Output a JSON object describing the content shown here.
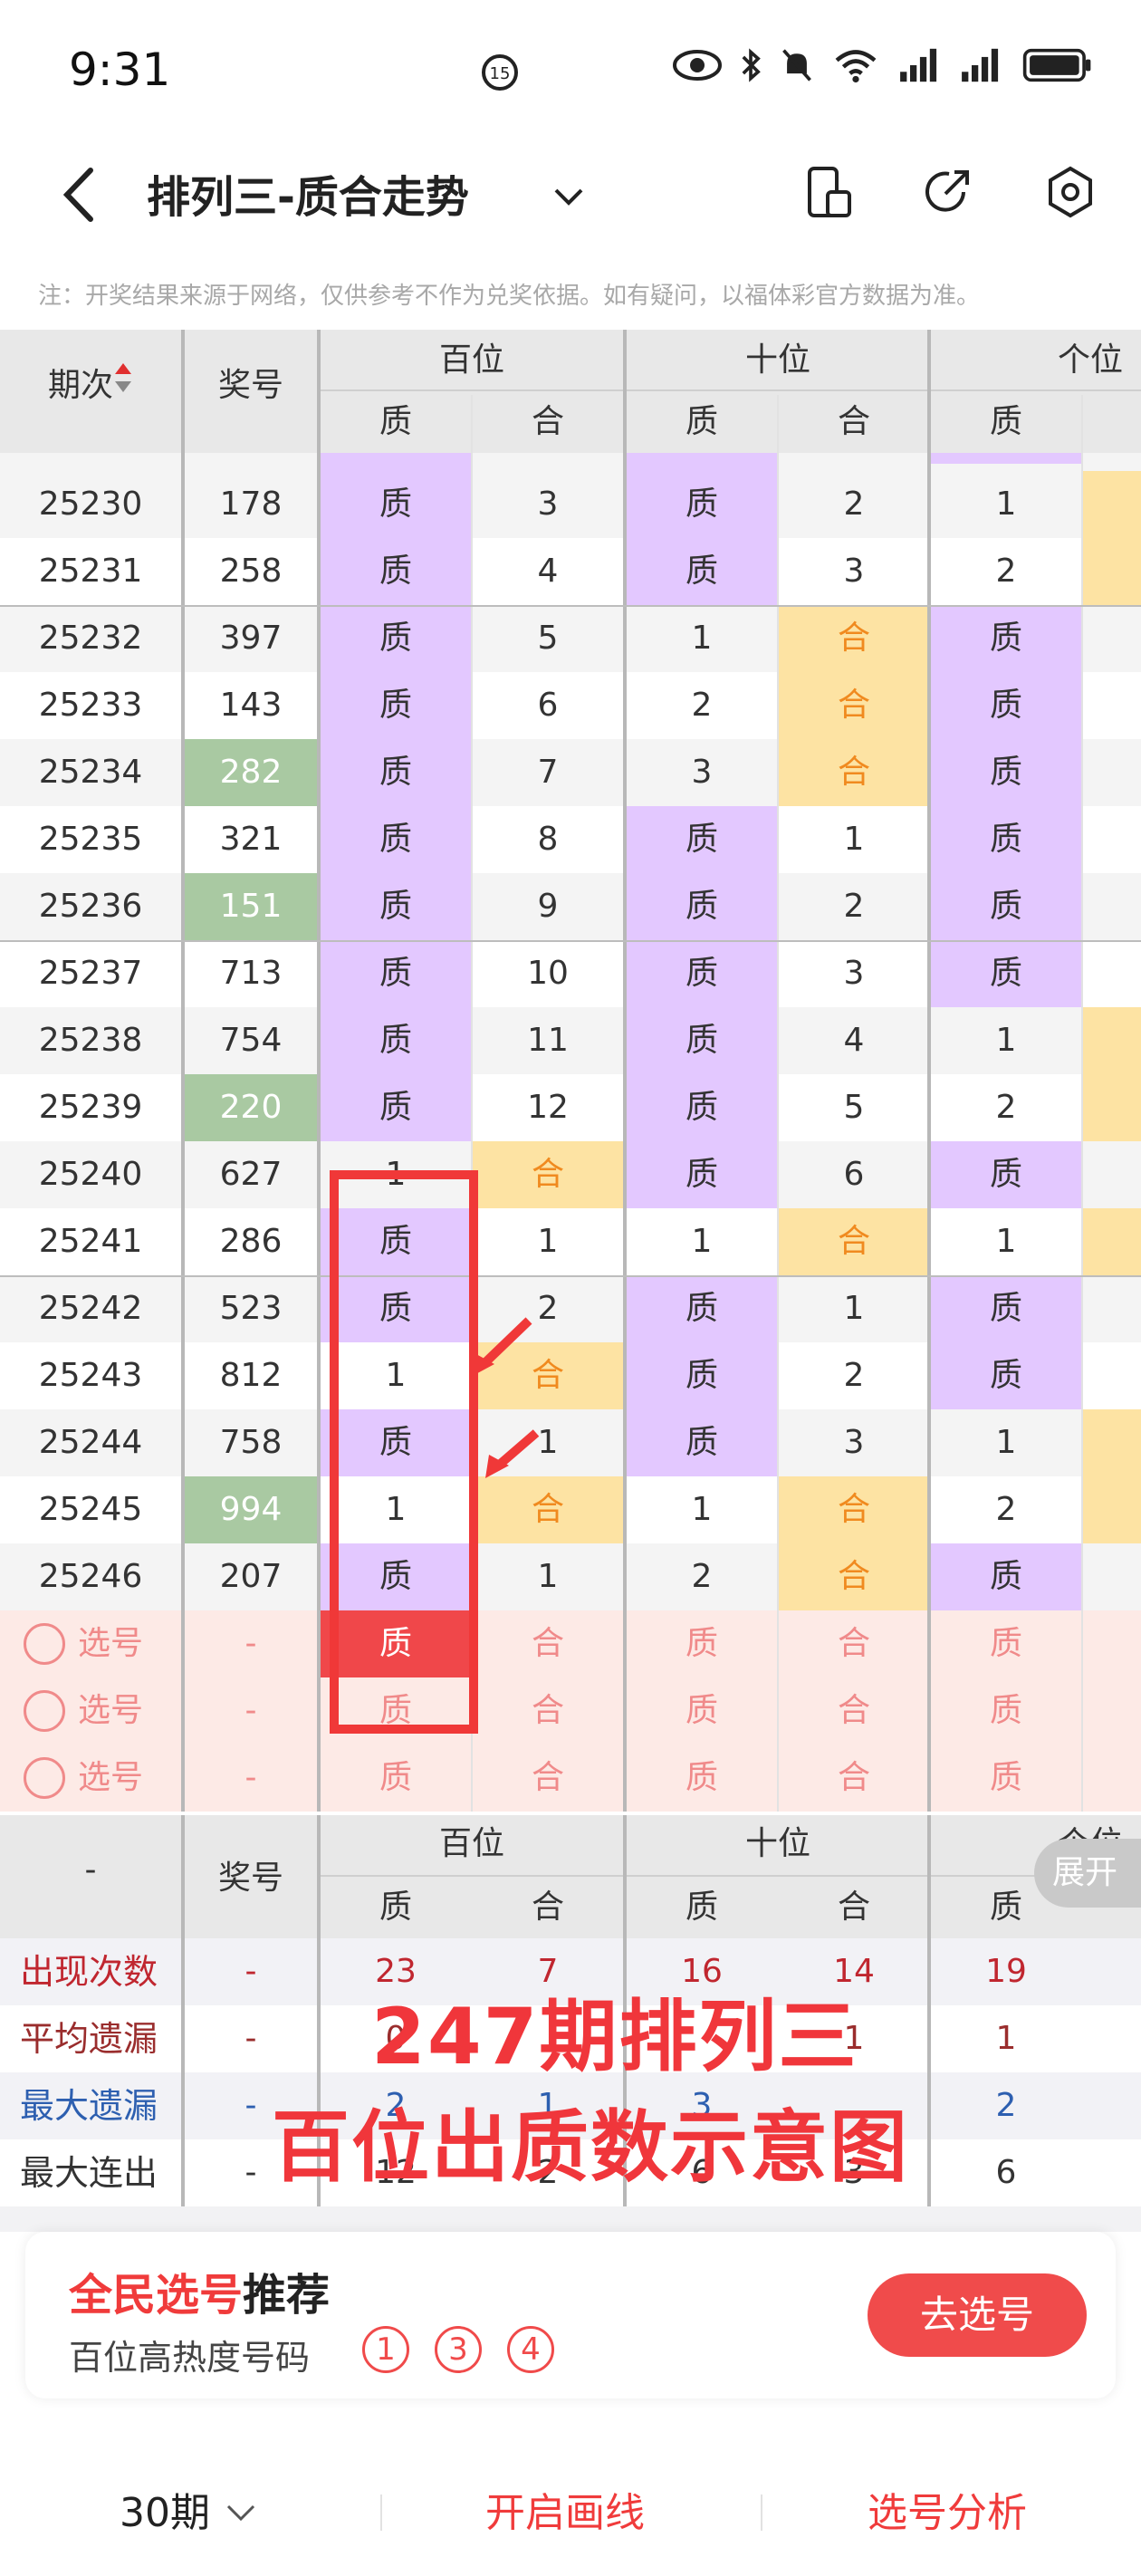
{
  "status_bar": {
    "time": "9:31"
  },
  "nav": {
    "title": "排列三-质合走势"
  },
  "note": "注：开奖结果来源于网络，仅供参考不作为兑奖依据。如有疑问，以福体彩官方数据为准。",
  "table_header": {
    "period": "期次",
    "number": "奖号",
    "groups": [
      "百位",
      "十位",
      "个位"
    ],
    "sub": [
      "质",
      "合",
      "质",
      "合",
      "质"
    ]
  },
  "rows": [
    {
      "period": "25230",
      "num": "178",
      "green": false,
      "c": [
        [
          "质",
          "p"
        ],
        [
          "3",
          ""
        ],
        [
          "质",
          "p"
        ],
        [
          "2",
          ""
        ],
        [
          "1",
          ""
        ]
      ],
      "g": "h"
    },
    {
      "period": "25231",
      "num": "258",
      "green": false,
      "c": [
        [
          "质",
          "p"
        ],
        [
          "4",
          ""
        ],
        [
          "质",
          "p"
        ],
        [
          "3",
          ""
        ],
        [
          "2",
          ""
        ]
      ],
      "g": "h"
    },
    {
      "period": "25232",
      "num": "397",
      "green": false,
      "c": [
        [
          "质",
          "p"
        ],
        [
          "5",
          ""
        ],
        [
          "1",
          ""
        ],
        [
          "合",
          "h"
        ],
        [
          "质",
          "p"
        ]
      ],
      "g": ""
    },
    {
      "period": "25233",
      "num": "143",
      "green": false,
      "c": [
        [
          "质",
          "p"
        ],
        [
          "6",
          ""
        ],
        [
          "2",
          ""
        ],
        [
          "合",
          "h"
        ],
        [
          "质",
          "p"
        ]
      ],
      "g": ""
    },
    {
      "period": "25234",
      "num": "282",
      "green": true,
      "c": [
        [
          "质",
          "p"
        ],
        [
          "7",
          ""
        ],
        [
          "3",
          ""
        ],
        [
          "合",
          "h"
        ],
        [
          "质",
          "p"
        ]
      ],
      "g": ""
    },
    {
      "period": "25235",
      "num": "321",
      "green": false,
      "c": [
        [
          "质",
          "p"
        ],
        [
          "8",
          ""
        ],
        [
          "质",
          "p"
        ],
        [
          "1",
          ""
        ],
        [
          "质",
          "p"
        ]
      ],
      "g": ""
    },
    {
      "period": "25236",
      "num": "151",
      "green": true,
      "c": [
        [
          "质",
          "p"
        ],
        [
          "9",
          ""
        ],
        [
          "质",
          "p"
        ],
        [
          "2",
          ""
        ],
        [
          "质",
          "p"
        ]
      ],
      "g": ""
    },
    {
      "period": "25237",
      "num": "713",
      "green": false,
      "c": [
        [
          "质",
          "p"
        ],
        [
          "10",
          ""
        ],
        [
          "质",
          "p"
        ],
        [
          "3",
          ""
        ],
        [
          "质",
          "p"
        ]
      ],
      "g": ""
    },
    {
      "period": "25238",
      "num": "754",
      "green": false,
      "c": [
        [
          "质",
          "p"
        ],
        [
          "11",
          ""
        ],
        [
          "质",
          "p"
        ],
        [
          "4",
          ""
        ],
        [
          "1",
          ""
        ]
      ],
      "g": "h"
    },
    {
      "period": "25239",
      "num": "220",
      "green": true,
      "c": [
        [
          "质",
          "p"
        ],
        [
          "12",
          ""
        ],
        [
          "质",
          "p"
        ],
        [
          "5",
          ""
        ],
        [
          "2",
          ""
        ]
      ],
      "g": "h"
    },
    {
      "period": "25240",
      "num": "627",
      "green": false,
      "c": [
        [
          "1",
          ""
        ],
        [
          "合",
          "h"
        ],
        [
          "质",
          "p"
        ],
        [
          "6",
          ""
        ],
        [
          "质",
          "p"
        ]
      ],
      "g": ""
    },
    {
      "period": "25241",
      "num": "286",
      "green": false,
      "c": [
        [
          "质",
          "p"
        ],
        [
          "1",
          ""
        ],
        [
          "1",
          ""
        ],
        [
          "合",
          "h"
        ],
        [
          "1",
          ""
        ]
      ],
      "g": "h"
    },
    {
      "period": "25242",
      "num": "523",
      "green": false,
      "c": [
        [
          "质",
          "p"
        ],
        [
          "2",
          ""
        ],
        [
          "质",
          "p"
        ],
        [
          "1",
          ""
        ],
        [
          "质",
          "p"
        ]
      ],
      "g": ""
    },
    {
      "period": "25243",
      "num": "812",
      "green": false,
      "c": [
        [
          "1",
          ""
        ],
        [
          "合",
          "h"
        ],
        [
          "质",
          "p"
        ],
        [
          "2",
          ""
        ],
        [
          "质",
          "p"
        ]
      ],
      "g": ""
    },
    {
      "period": "25244",
      "num": "758",
      "green": false,
      "c": [
        [
          "质",
          "p"
        ],
        [
          "1",
          ""
        ],
        [
          "质",
          "p"
        ],
        [
          "3",
          ""
        ],
        [
          "1",
          ""
        ]
      ],
      "g": "h"
    },
    {
      "period": "25245",
      "num": "994",
      "green": true,
      "c": [
        [
          "1",
          ""
        ],
        [
          "合",
          "h"
        ],
        [
          "1",
          ""
        ],
        [
          "合",
          "h"
        ],
        [
          "2",
          ""
        ]
      ],
      "g": "h"
    },
    {
      "period": "25246",
      "num": "207",
      "green": false,
      "c": [
        [
          "质",
          "p"
        ],
        [
          "1",
          ""
        ],
        [
          "2",
          ""
        ],
        [
          "合",
          "h"
        ],
        [
          "质",
          "p"
        ]
      ],
      "g": ""
    }
  ],
  "pick_rows": [
    {
      "label": "选号",
      "num": "-",
      "c": [
        "质",
        "合",
        "质",
        "合",
        "质"
      ]
    },
    {
      "label": "选号",
      "num": "-",
      "c": [
        "质",
        "合",
        "质",
        "合",
        "质"
      ]
    },
    {
      "label": "选号",
      "num": "-",
      "c": [
        "质",
        "合",
        "质",
        "合",
        "质"
      ]
    }
  ],
  "stats_header": {
    "left": "-",
    "number": "奖号",
    "groups": [
      "百位",
      "十位",
      "个位"
    ],
    "sub": [
      "质",
      "合",
      "质",
      "合",
      "质"
    ]
  },
  "stats": [
    {
      "label": "出现次数",
      "color": "#c0262f",
      "num": "-",
      "vals": [
        "23",
        "7",
        "16",
        "14",
        "19"
      ]
    },
    {
      "label": "平均遗漏",
      "color": "#9a2d2d",
      "num": "-",
      "vals": [
        "0",
        "",
        "",
        "1",
        "1"
      ]
    },
    {
      "label": "最大遗漏",
      "color": "#2d5fb0",
      "num": "-",
      "vals": [
        "2",
        "1",
        "3",
        "",
        "2"
      ]
    },
    {
      "label": "最大连出",
      "color": "#333333",
      "num": "-",
      "vals": [
        "12",
        "2",
        "6",
        "3",
        "6"
      ]
    }
  ],
  "expand_label": "展开",
  "overlay": {
    "line1": "247期排列三",
    "line2": "百位出质数示意图"
  },
  "card": {
    "title_red": "全民选号",
    "title_black": "推荐",
    "subtitle": "百位高热度号码",
    "balls": [
      "1",
      "3",
      "4"
    ],
    "button": "去选号"
  },
  "bottom_bar": {
    "periods": "30期",
    "draw_line": "开启画线",
    "analysis": "选号分析"
  },
  "colors": {
    "prime": "#e3c8ff",
    "composite": "#fde3a3",
    "accent_red": "#f0474a",
    "green": "#a9c9a2"
  }
}
